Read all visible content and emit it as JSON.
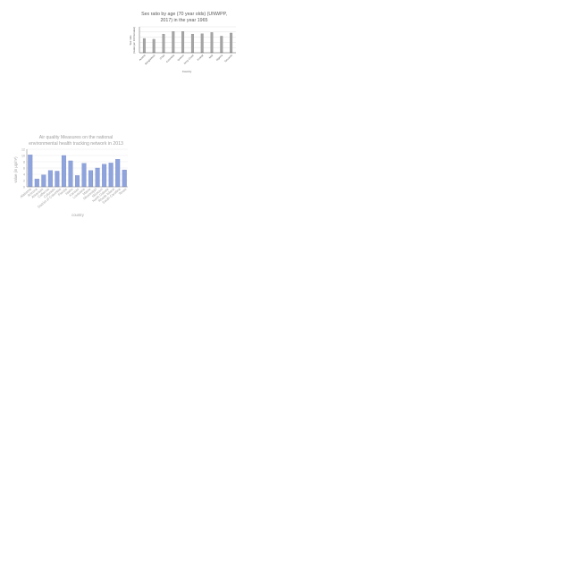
{
  "chart_data": [
    {
      "type": "bar",
      "title_lines": [
        "Sex ratio by age (70 year olds) (UNWPP,",
        "2017) in the year 1965"
      ],
      "xlabel": "Country",
      "ylabel_lines": [
        "Sex ratio",
        "(males per 100 females)"
      ],
      "categories": [
        "Austria",
        "Bangladesh",
        "Chad",
        "Colombia",
        "Greece",
        "Ivory Coast",
        "Kuwait",
        "Mali",
        "Nigeria",
        "Tanzania"
      ],
      "values": [
        55,
        52,
        72,
        82,
        82,
        72,
        73,
        78,
        64,
        76
      ],
      "ylim": [
        0,
        100
      ],
      "grid": true,
      "colors": {
        "bar": "#a6a6a6",
        "bar_edge": "#7f7f7f",
        "grid": "#d9d9d9",
        "axis": "#595959",
        "text": "#595959"
      }
    },
    {
      "type": "bar",
      "title_lines": [
        "Air quality Measures on the national",
        "environmental health tracking network in 2013"
      ],
      "xlabel": "country",
      "ylabel_lines": [
        "value (in µg/m³)"
      ],
      "categories": [
        "Alabama",
        "Arizona",
        "Arkansas",
        "Calfornia",
        "Colorado",
        "District of Columbia",
        "Florida",
        "Idaho",
        "Kansas",
        "Louisiana",
        "Maine",
        "Mississippi",
        "Missouri",
        "North Dakota",
        "Rhode Island",
        "South Carolina",
        "Texas"
      ],
      "values": [
        10.2,
        2.5,
        3.8,
        5.2,
        5.0,
        10.0,
        8.3,
        3.6,
        7.5,
        5.2,
        6.0,
        7.2,
        7.6,
        8.8,
        5.4
      ],
      "ylim": [
        0,
        12
      ],
      "yticks": [
        "0",
        "2",
        "4",
        "6",
        "8",
        "10",
        "12"
      ],
      "grid": true,
      "colors": {
        "bar": "#8fa4dc",
        "bar_edge": "#6a7fc0",
        "grid": "#e6e6e6",
        "axis": "#8a8a8a",
        "text": "#a0a0a0"
      }
    }
  ]
}
